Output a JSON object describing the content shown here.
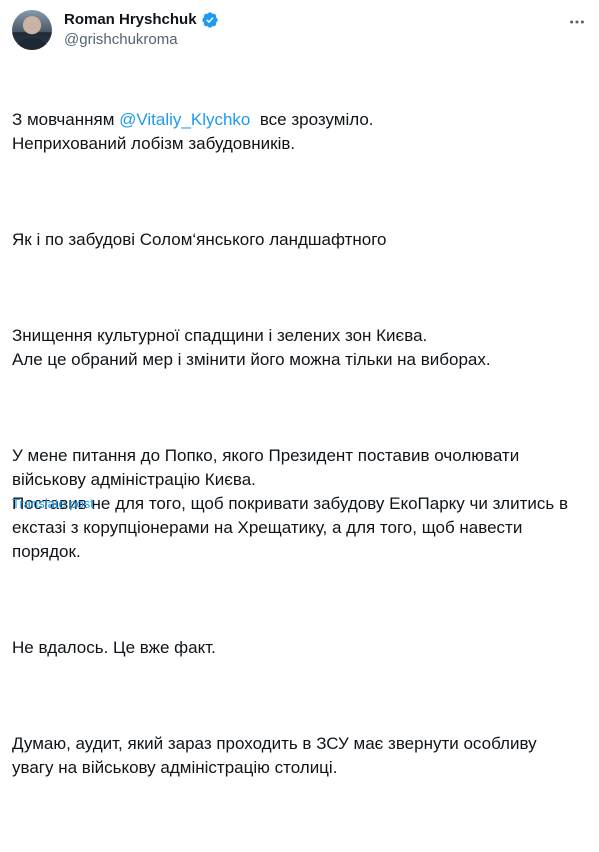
{
  "author": {
    "display_name": "Roman Hryshchuk",
    "handle": "@grishchukroma"
  },
  "icons": {
    "verified": "verified-badge-icon",
    "more": "more-options-icon"
  },
  "colors": {
    "link": "#1d9bf0",
    "text": "#0f1419",
    "secondary": "#536471"
  },
  "tweet": {
    "p1_pre": "З мовчанням ",
    "mention": "@Vitaliy_Klychko",
    "p1_post": "  все зрозуміло.\nНеприхований лобізм забудовників.",
    "p2": "Як і по забудові Солом‘янського ландшафтного",
    "p3": "Знищення культурної спадщини і зелених зон Києва.\nАле це обраний мер і змінити його можна тільки на виборах.",
    "p4": "У мене питання до Попко, якого Президент поставив очолювати військову адміністрацію Києва.\nПоставив не для того, щоб покривати забудову ЕкоПарку чи злитись в екстазі з корупціонерами на Хрещатику, а для того, щоб навести порядок.",
    "p5": "Не вдалось. Це вже факт.",
    "p6": "Думаю, аудит, який зараз проходить в ЗСУ має звернути особливу увагу на військову адміністрацію столиці."
  },
  "translate_label": "Translate post"
}
